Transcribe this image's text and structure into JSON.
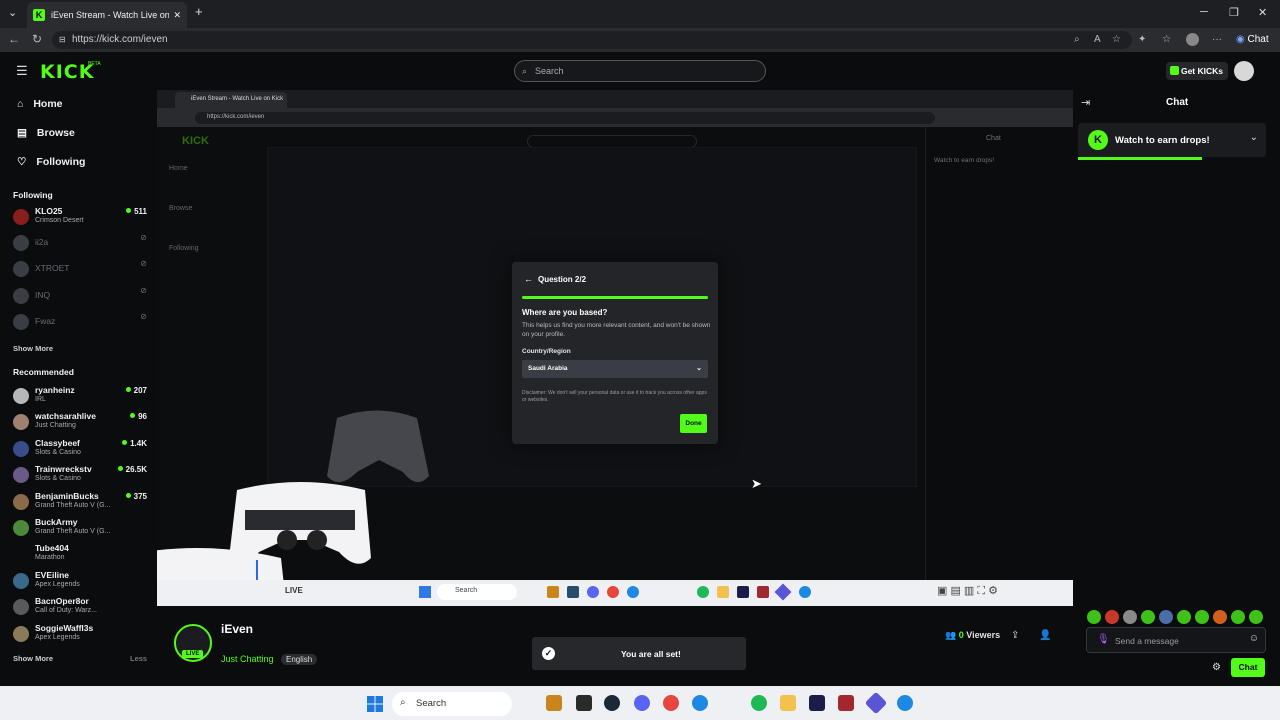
{
  "browser": {
    "tab_title": "iEven Stream - Watch Live on Kick",
    "url": "https://kick.com/ieven",
    "new_tab": "+",
    "copilot_label": "Chat"
  },
  "header": {
    "logo": "KICK",
    "logo_badge": "BETA",
    "search_placeholder": "Search",
    "get_kicks_label": "Get KICKs"
  },
  "nav": {
    "home": "Home",
    "browse": "Browse",
    "following": "Following"
  },
  "sidebar": {
    "following_title": "Following",
    "following": [
      {
        "name": "KLO25",
        "category": "Crimson Desert",
        "viewers": "511",
        "live": true
      },
      {
        "name": "ii2a",
        "category": "",
        "viewers": "",
        "live": false
      },
      {
        "name": "XTROET",
        "category": "",
        "viewers": "",
        "live": false
      },
      {
        "name": "INQ",
        "category": "",
        "viewers": "",
        "live": false
      },
      {
        "name": "Fwaz",
        "category": "",
        "viewers": "",
        "live": false
      }
    ],
    "show_more_following": "Show More",
    "recommended_title": "Recommended",
    "recommended": [
      {
        "name": "ryanheinz",
        "category": "IRL",
        "viewers": "207"
      },
      {
        "name": "watchsarahlive",
        "category": "Just Chatting",
        "viewers": "96"
      },
      {
        "name": "Classybeef",
        "category": "Slots & Casino",
        "viewers": "1.4K"
      },
      {
        "name": "Trainwreckstv",
        "category": "Slots & Casino",
        "viewers": "26.5K"
      },
      {
        "name": "BenjaminBucks",
        "category": "Grand Theft Auto V (G...",
        "viewers": "375"
      },
      {
        "name": "BuckArmy",
        "category": "Grand Theft Auto V (G...",
        "viewers": ""
      },
      {
        "name": "Tube404",
        "category": "Marathon",
        "viewers": ""
      },
      {
        "name": "EVEiline",
        "category": "Apex Legends",
        "viewers": ""
      },
      {
        "name": "BacnOper8or",
        "category": "Call of Duty: Warz...",
        "viewers": ""
      },
      {
        "name": "SoggieWaffl3s",
        "category": "Apex Legends",
        "viewers": ""
      }
    ],
    "show_more_recommended": "Show More",
    "show_less": "Less"
  },
  "modal": {
    "title": "Question 2/2",
    "progress": 1.0,
    "question": "Where are you based?",
    "help": "This helps us find you more relevant content, and won't be shown on your profile.",
    "field_label": "Country/Region",
    "selected_country": "Saudi Arabia",
    "disclaimer": "Disclaimer: We don't sell your personal data or use it to track you across other apps or websites.",
    "done_label": "Done"
  },
  "inner_capture": {
    "sidebar_text": "Home\n\nBrowse\n\nFollowing",
    "chat_title": "Chat",
    "drops_text": "Watch to earn drops!",
    "taskbar_search": "Search"
  },
  "stream_info": {
    "streamer_name": "iEven",
    "live_badge": "LIVE",
    "category": "Just Chatting",
    "language": "English",
    "viewers_count": "0",
    "viewers_label": "Viewers",
    "live_overlay": "LIVE"
  },
  "toast": {
    "message": "You are all set!"
  },
  "chat": {
    "title": "Chat",
    "drops_label": "Watch to earn drops!",
    "drops_progress": 0.62,
    "message_placeholder": "Send a message",
    "send_label": "Chat"
  },
  "taskbar": {
    "search_label": "Search"
  },
  "colors": {
    "accent": "#53fc18",
    "background": "#0b0c0e",
    "panel": "#1a1c20"
  }
}
